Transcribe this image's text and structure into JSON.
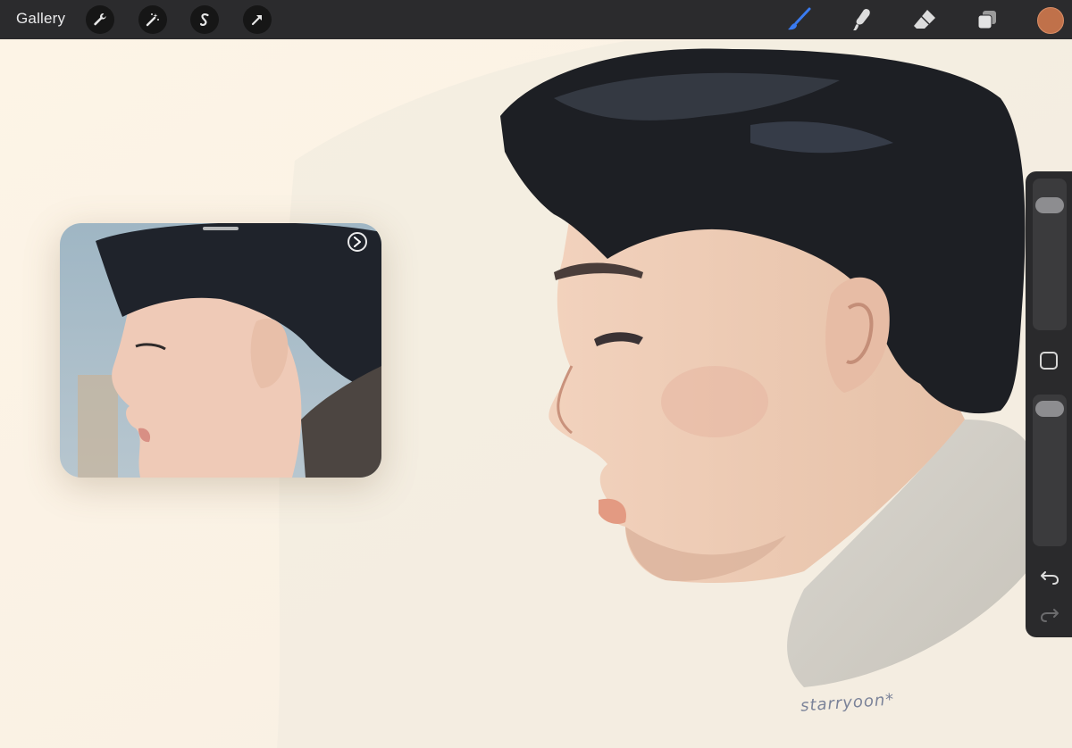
{
  "toolbar": {
    "gallery_label": "Gallery",
    "left_tools": [
      "wrench-icon",
      "magic-wand-icon",
      "selection-icon",
      "transform-icon"
    ],
    "right_tools": [
      "brush-icon",
      "smudge-icon",
      "eraser-icon",
      "layers-icon"
    ],
    "active_tool": "brush-icon",
    "color": "#c0714a"
  },
  "reference": {
    "play_icon": "play-circle-icon"
  },
  "sidebar": {
    "size_level": 0.12,
    "opacity_level": 0.02,
    "icons": [
      "modify-square-icon",
      "undo-icon",
      "redo-icon"
    ]
  },
  "artwork": {
    "signature": "starryoon*"
  }
}
